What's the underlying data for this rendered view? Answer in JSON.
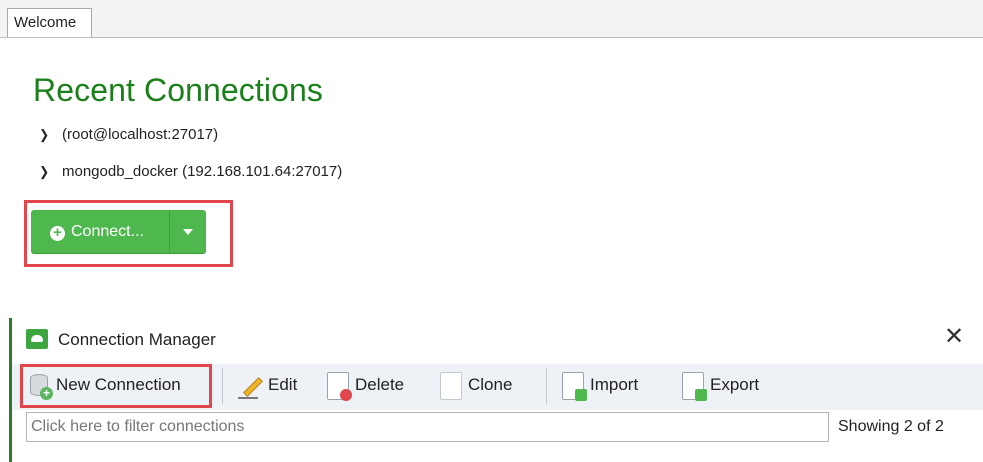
{
  "welcome": {
    "tab_label": "Welcome",
    "title": "Recent Connections",
    "recent": [
      {
        "label": "(root@localhost:27017)"
      },
      {
        "label": "mongodb_docker (192.168.101.64:27017)"
      }
    ],
    "connect_label": "Connect..."
  },
  "connection_manager": {
    "title": "Connection Manager",
    "toolbar": {
      "new_connection": "New Connection",
      "edit": "Edit",
      "delete": "Delete",
      "clone": "Clone",
      "import": "Import",
      "export": "Export"
    },
    "filter_placeholder": "Click here to filter connections",
    "showing": "Showing 2 of 2"
  },
  "colors": {
    "title_green": "#1b7f1b",
    "button_green": "#4eb84f",
    "highlight_red": "#e0474c"
  }
}
